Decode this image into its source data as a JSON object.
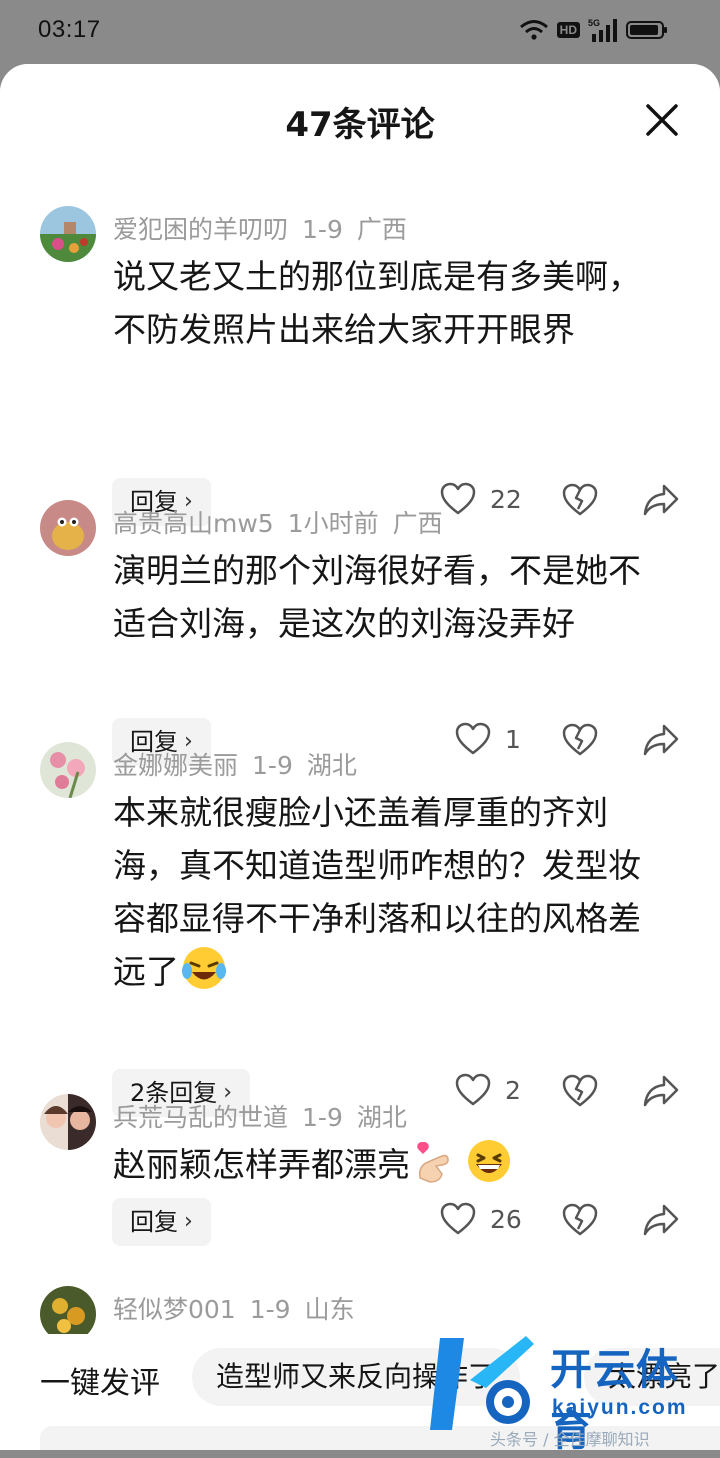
{
  "status_bar": {
    "time": "03:17",
    "network": "5G",
    "hd": "HD"
  },
  "header": {
    "title": "47条评论"
  },
  "comments": [
    {
      "user": "爱犯困的羊叨叨",
      "date": "1-9",
      "region": "广西",
      "text": "说又老又土的那位到底是有多美啊，不防发照片出来给大家开开眼界",
      "reply_label": "回复",
      "likes": "22"
    },
    {
      "user": "高贵高山mw5",
      "date": "1小时前",
      "region": "广西",
      "text": "演明兰的那个刘海很好看，不是她不适合刘海，是这次的刘海没弄好",
      "reply_label": "回复",
      "likes": "1"
    },
    {
      "user": "金娜娜美丽",
      "date": "1-9",
      "region": "湖北",
      "text": "本来就很瘦脸小还盖着厚重的齐刘海，真不知道造型师咋想的？发型妆容都显得不干净利落和以往的风格差远了",
      "emoji": [
        "laugh-cry-emoji"
      ],
      "reply_label": "2条回复",
      "likes": "2"
    },
    {
      "user": "兵荒马乱的世道",
      "date": "1-9",
      "region": "湖北",
      "text": "赵丽颖怎样弄都漂亮",
      "emoji": [
        "finger-heart-emoji",
        "grin-emoji"
      ],
      "reply_label": "回复",
      "likes": "26"
    },
    {
      "user": "轻似梦001",
      "date": "1-9",
      "region": "山东"
    }
  ],
  "quick_reply": {
    "label": "一键发评",
    "chips": [
      "造型师又来反向操作了",
      "太漂亮了"
    ]
  },
  "watermark": {
    "brand": "开云体育",
    "domain": "kaiyun.com",
    "tagline": "头条号 / 全佳摩聊知识"
  },
  "colors": {
    "meta": "#9b9b9b",
    "text": "#161616",
    "chip_bg": "#f3f3f3",
    "brand_blue": "#1565c0"
  }
}
